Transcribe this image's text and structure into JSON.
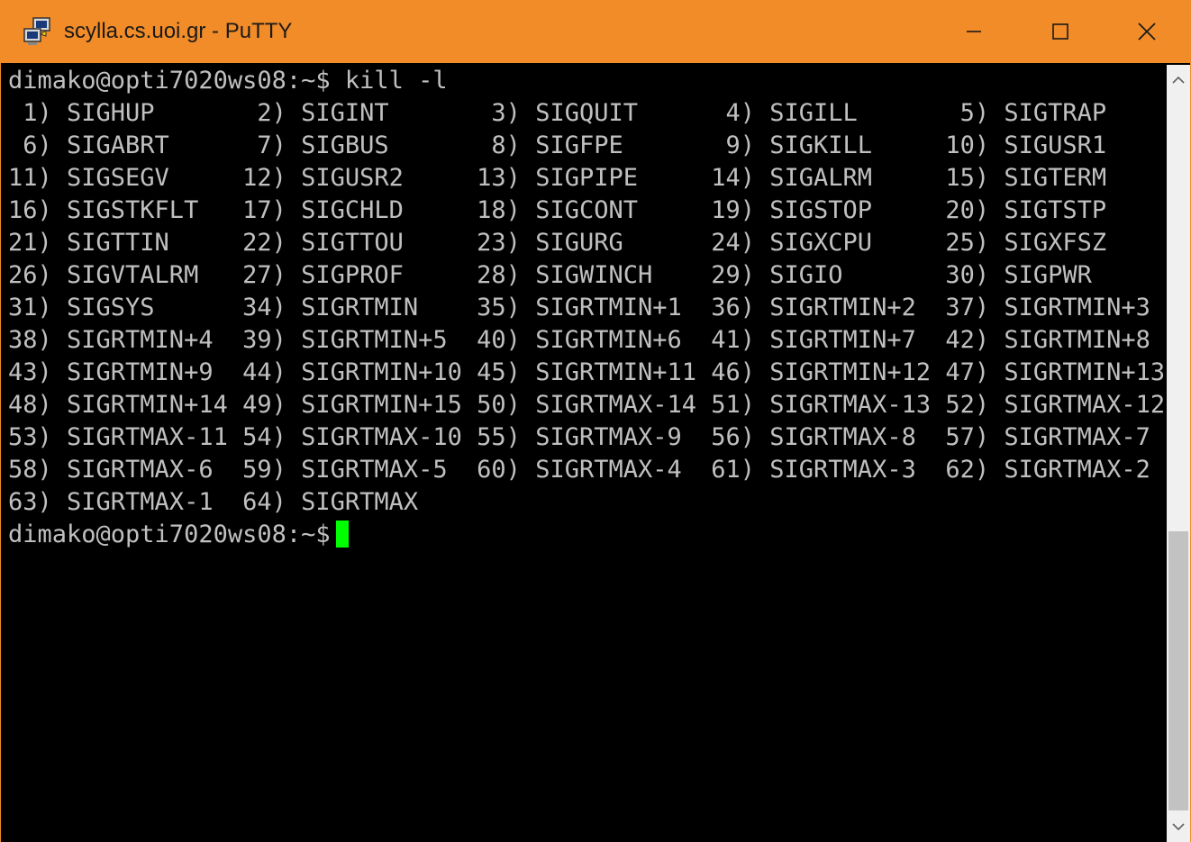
{
  "window": {
    "title": "scylla.cs.uoi.gr - PuTTY",
    "accent_color": "#f28c28",
    "controls": [
      {
        "name": "minimize-icon",
        "glyph": "—"
      },
      {
        "name": "maximize-icon",
        "glyph": "☐"
      },
      {
        "name": "close-icon",
        "glyph": "✕"
      }
    ]
  },
  "terminal": {
    "lines": [
      "dimako@opti7020ws08:~$ kill -l",
      " 1) SIGHUP       2) SIGINT       3) SIGQUIT      4) SIGILL       5) SIGTRAP",
      " 6) SIGABRT      7) SIGBUS       8) SIGFPE       9) SIGKILL     10) SIGUSR1",
      "11) SIGSEGV     12) SIGUSR2     13) SIGPIPE     14) SIGALRM     15) SIGTERM",
      "16) SIGSTKFLT   17) SIGCHLD     18) SIGCONT     19) SIGSTOP     20) SIGTSTP",
      "21) SIGTTIN     22) SIGTTOU     23) SIGURG      24) SIGXCPU     25) SIGXFSZ",
      "26) SIGVTALRM   27) SIGPROF     28) SIGWINCH    29) SIGIO       30) SIGPWR",
      "31) SIGSYS      34) SIGRTMIN    35) SIGRTMIN+1  36) SIGRTMIN+2  37) SIGRTMIN+3",
      "38) SIGRTMIN+4  39) SIGRTMIN+5  40) SIGRTMIN+6  41) SIGRTMIN+7  42) SIGRTMIN+8",
      "43) SIGRTMIN+9  44) SIGRTMIN+10 45) SIGRTMIN+11 46) SIGRTMIN+12 47) SIGRTMIN+13",
      "48) SIGRTMIN+14 49) SIGRTMIN+15 50) SIGRTMAX-14 51) SIGRTMAX-13 52) SIGRTMAX-12",
      "53) SIGRTMAX-11 54) SIGRTMAX-10 55) SIGRTMAX-9  56) SIGRTMAX-8  57) SIGRTMAX-7",
      "58) SIGRTMAX-6  59) SIGRTMAX-5  60) SIGRTMAX-4  61) SIGRTMAX-3  62) SIGRTMAX-2",
      "63) SIGRTMAX-1  64) SIGRTMAX"
    ],
    "prompt": "dimako@opti7020ws08:~$",
    "text_color": "#c0c0c0",
    "cursor_color": "#00ff00"
  },
  "scrollbar": {
    "up_glyph": "⌃",
    "down_glyph": "⌄"
  }
}
